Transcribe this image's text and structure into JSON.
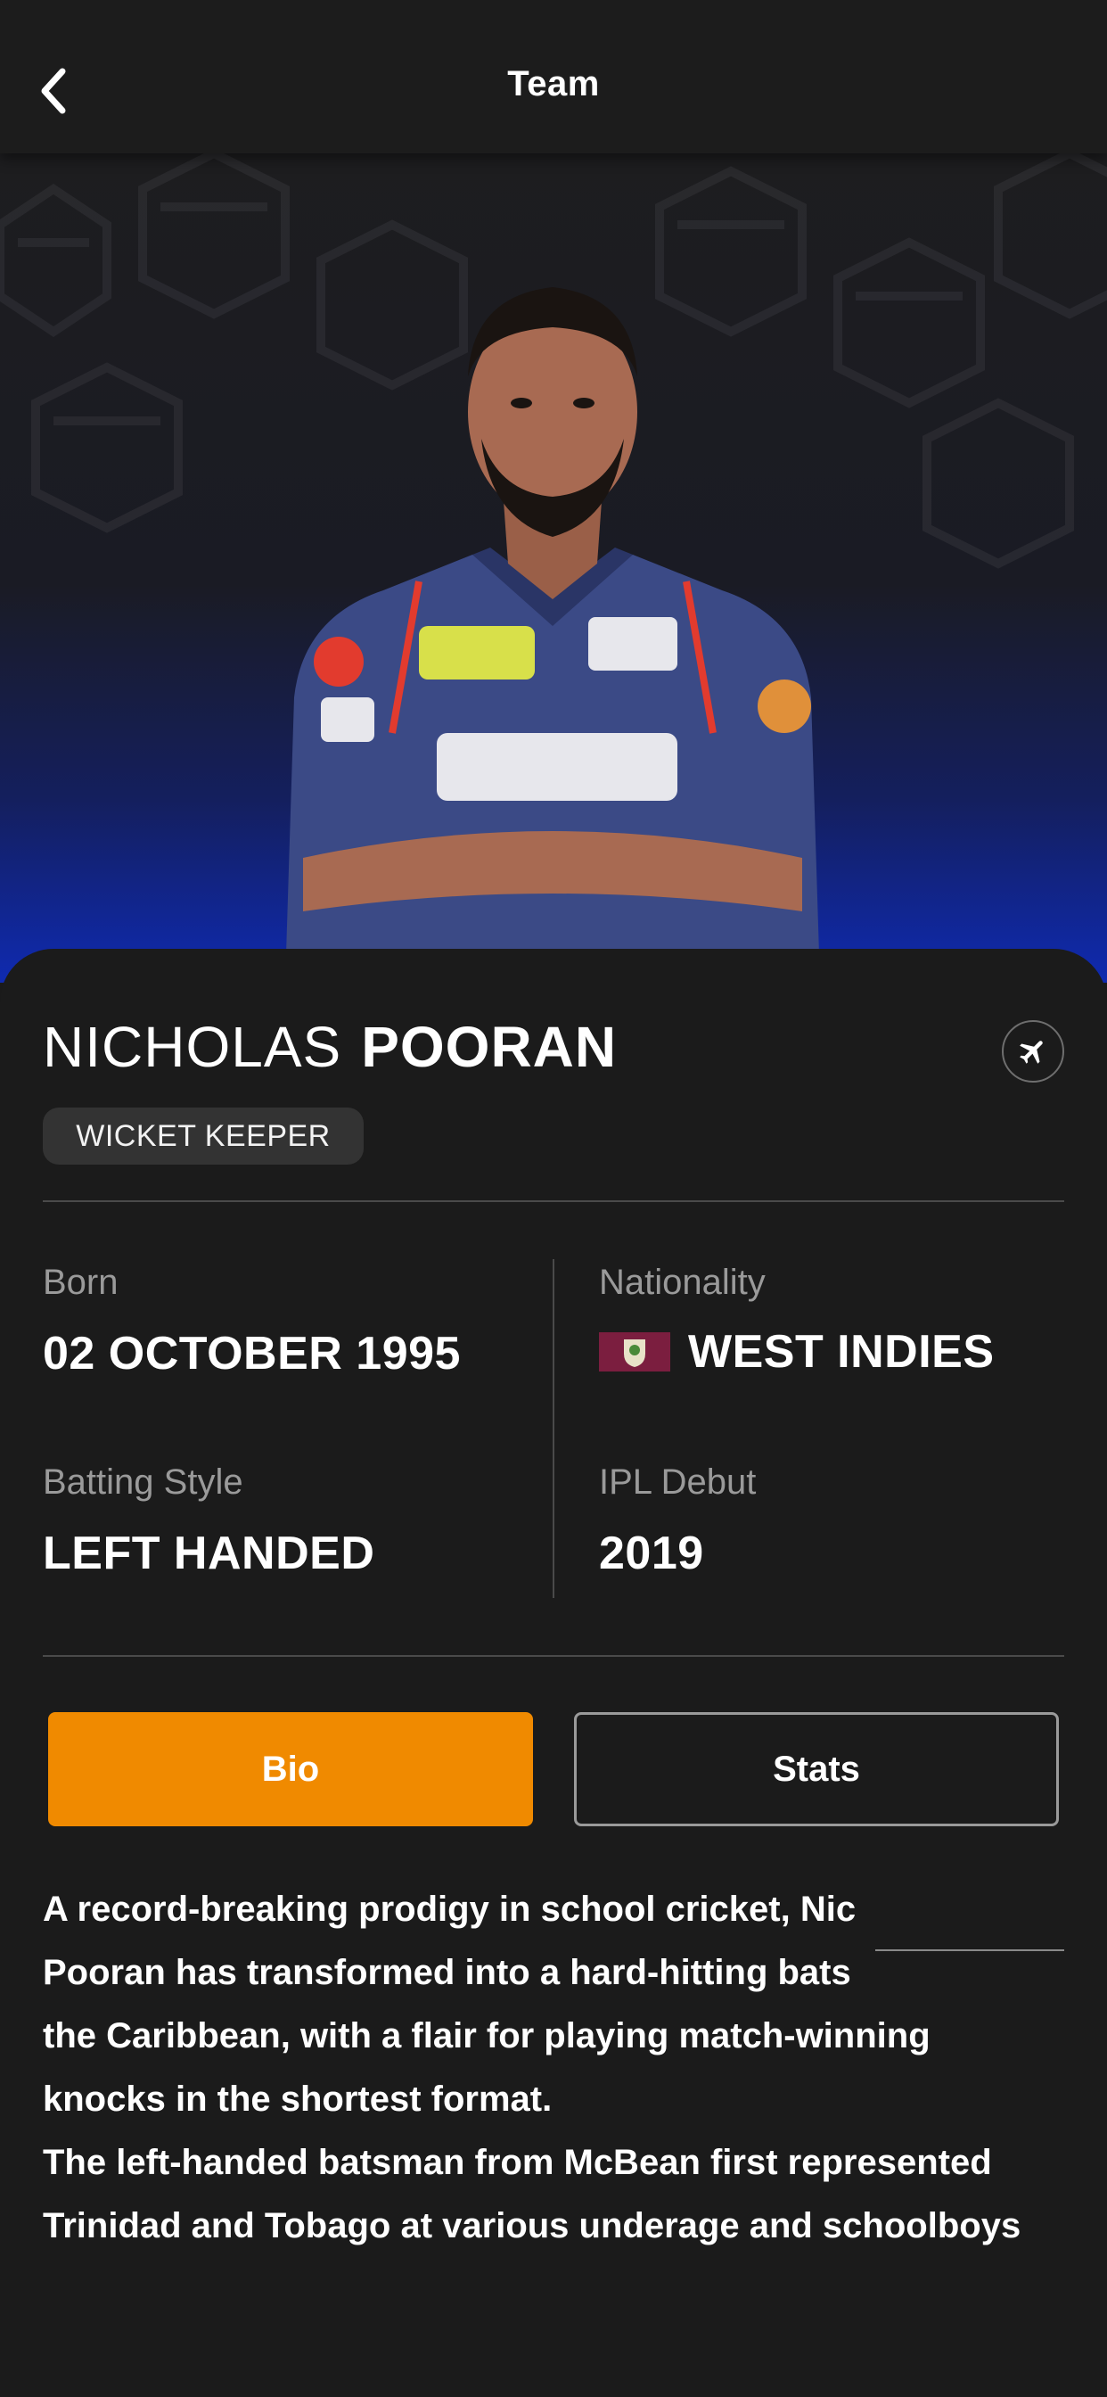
{
  "header": {
    "title": "Team",
    "back_icon": "chevron-left-icon"
  },
  "player": {
    "first_name": "NICHOLAS",
    "last_name": "POORAN",
    "role": "WICKET KEEPER",
    "overseas_icon": "airplane-icon"
  },
  "info": {
    "born_label": "Born",
    "born_value": "02 OCTOBER 1995",
    "nationality_label": "Nationality",
    "nationality_value": "WEST INDIES",
    "batting_label": "Batting Style",
    "batting_value": "LEFT HANDED",
    "debut_label": "IPL Debut",
    "debut_value": "2019"
  },
  "tabs": {
    "bio_label": "Bio",
    "stats_label": "Stats",
    "active": "Bio"
  },
  "bio": {
    "lines": [
      "A record-breaking prodigy in school cricket, Nic",
      "Pooran has transformed into a hard-hitting bats",
      "the Caribbean, with a flair for playing match-winning",
      "knocks in the shortest format.",
      "The left-handed batsman from McBean first represented",
      "Trinidad and Tobago at various underage and schoolboys"
    ]
  },
  "colors": {
    "background": "#1a1a1a",
    "accent": "#f08a00",
    "hero_blue": "#0f2ab0",
    "jersey": "#3b4a86"
  }
}
